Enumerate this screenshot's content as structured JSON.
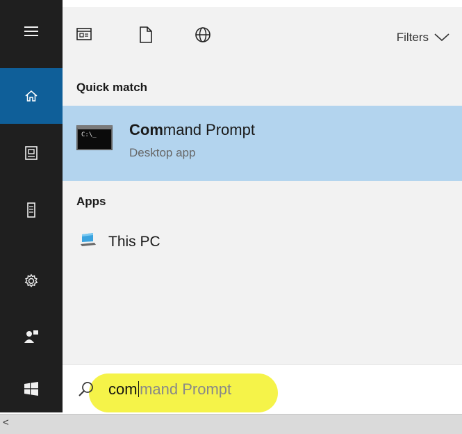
{
  "rail": {
    "items": [
      {
        "icon": "hamburger-menu-icon"
      },
      {
        "icon": "home-icon",
        "active": true
      },
      {
        "icon": "documents-icon"
      },
      {
        "icon": "device-icon"
      },
      {
        "icon": "settings-gear-icon"
      },
      {
        "icon": "user-feedback-icon"
      },
      {
        "icon": "windows-start-icon"
      }
    ],
    "colors": {
      "background": "#1f1f1f",
      "active": "#0f5f99"
    }
  },
  "toolbar": {
    "icons": [
      "apps-filter-icon",
      "documents-filter-icon",
      "web-filter-icon"
    ],
    "filters_label": "Filters"
  },
  "results": {
    "quick_match_label": "Quick match",
    "top_result": {
      "title_bold": "Com",
      "title_rest": "mand Prompt",
      "subtitle": "Desktop app",
      "icon": "command-prompt-icon",
      "icon_text": "C:\\_",
      "highlight_color": "#b3d4ee"
    },
    "apps_label": "Apps",
    "apps": [
      {
        "label": "This PC",
        "icon": "this-pc-icon"
      }
    ]
  },
  "search": {
    "typed": "com",
    "suggestion": "mand Prompt",
    "icon": "search-icon",
    "highlight_color": "#f4f23a"
  },
  "scrollbar": {
    "left_arrow": "<"
  }
}
